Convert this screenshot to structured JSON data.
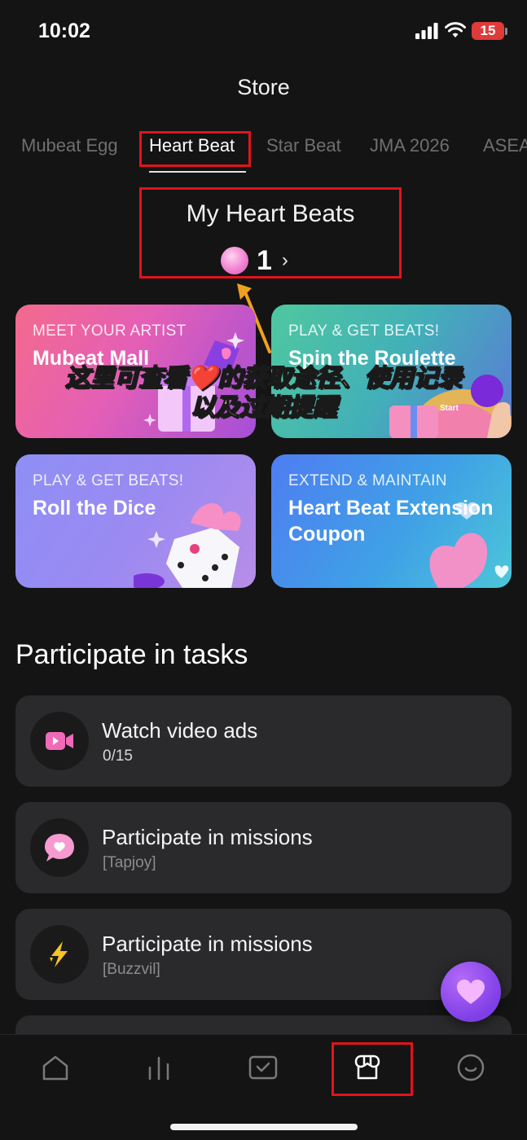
{
  "status_bar": {
    "time": "10:02",
    "battery": "15"
  },
  "header": {
    "title": "Store"
  },
  "tabs": [
    {
      "label": "Mubeat Egg",
      "active": false
    },
    {
      "label": "Heart Beat",
      "active": true
    },
    {
      "label": "Star Beat",
      "active": false
    },
    {
      "label": "JMA 2026",
      "active": false
    },
    {
      "label": "ASEA",
      "active": false
    }
  ],
  "balance": {
    "title": "My Heart Beats",
    "count": "1",
    "chevron": "›"
  },
  "cards": [
    {
      "kicker": "MEET YOUR ARTIST",
      "title": "Mubeat Mall"
    },
    {
      "kicker": "PLAY & GET BEATS!",
      "title": "Spin the Roulette",
      "badge": "Start"
    },
    {
      "kicker": "PLAY & GET BEATS!",
      "title": "Roll the Dice"
    },
    {
      "kicker": "EXTEND & MAINTAIN",
      "title": "Heart Beat Extension Coupon"
    }
  ],
  "annotation": {
    "line1": "这里可查看❤️的获取途径、使用记录",
    "line2": "以及过期提醒"
  },
  "tasks_section": {
    "title": "Participate in tasks"
  },
  "tasks": [
    {
      "name": "Watch video ads",
      "sub": "0/15",
      "icon": "video-icon"
    },
    {
      "name": "Participate in missions",
      "sub": "[Tapjoy]",
      "icon": "chat-heart-icon"
    },
    {
      "name": "Participate in missions",
      "sub": "[Buzzvil]",
      "icon": "lightning-icon"
    }
  ],
  "bottom_nav": [
    {
      "icon": "home-icon"
    },
    {
      "icon": "chart-icon"
    },
    {
      "icon": "vote-icon"
    },
    {
      "icon": "store-icon",
      "active": true
    },
    {
      "icon": "profile-icon"
    }
  ],
  "colors": {
    "highlight": "#e0141b",
    "background": "#141414",
    "card_bg": "#2a2a2c",
    "annotation_text": "#f6f08c"
  }
}
